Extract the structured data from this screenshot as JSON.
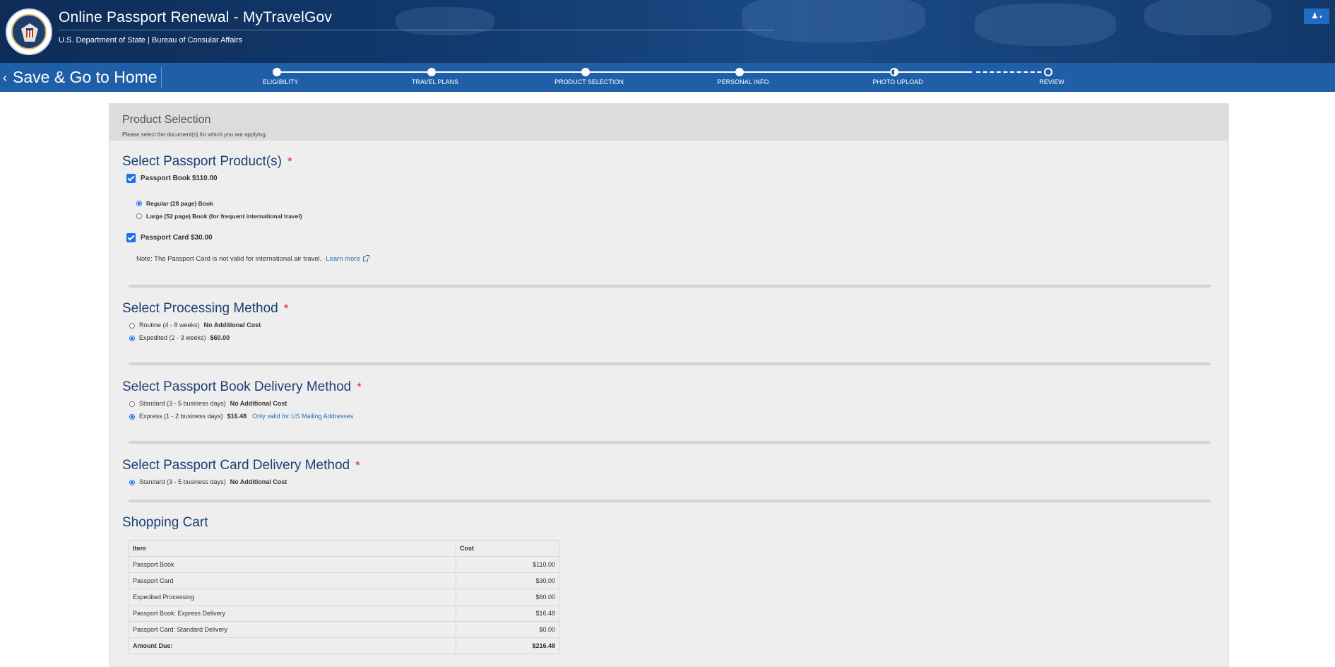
{
  "header": {
    "title": "Online Passport Renewal - MyTravelGov",
    "subtitle": "U.S. Department of State | Bureau of Consular Affairs",
    "seal_icon": "department-of-state-seal",
    "user_menu_icon": "user-icon"
  },
  "nav": {
    "back_label": "Save & Go to Home",
    "steps": [
      {
        "label": "ELIGIBILITY",
        "state": "complete"
      },
      {
        "label": "TRAVEL PLANS",
        "state": "complete"
      },
      {
        "label": "PRODUCT SELECTION",
        "state": "complete"
      },
      {
        "label": "PERSONAL INFO",
        "state": "complete"
      },
      {
        "label": "PHOTO UPLOAD",
        "state": "current"
      },
      {
        "label": "REVIEW",
        "state": "incomplete"
      }
    ]
  },
  "panel": {
    "title": "Product Selection",
    "description": "Please select the document(s) for which you are applying."
  },
  "products": {
    "title": "Select Passport Product(s)",
    "required_mark": "*",
    "book": {
      "label": "Passport Book",
      "price": "$110.00",
      "checked": true
    },
    "book_options": [
      {
        "label": "Regular (28 page) Book",
        "selected": true
      },
      {
        "label": "Large (52 page) Book (for frequent international travel)",
        "selected": false
      }
    ],
    "card": {
      "label": "Passport Card",
      "price": "$30.00",
      "checked": true
    },
    "card_note": "Note: The Passport Card is not valid for international air travel.",
    "learn_more": "Learn more"
  },
  "processing": {
    "title": "Select Processing Method",
    "required_mark": "*",
    "options": [
      {
        "label": "Routine (4 - 8 weeks)",
        "cost": "No Additional Cost",
        "selected": false
      },
      {
        "label": "Expedited (2 - 3 weeks)",
        "cost": "$60.00",
        "selected": true
      }
    ]
  },
  "book_delivery": {
    "title": "Select Passport Book Delivery Method",
    "required_mark": "*",
    "options": [
      {
        "label": "Standard (3 - 5 business days)",
        "cost": "No Additional Cost",
        "note": "",
        "selected": false
      },
      {
        "label": "Express (1 - 2 business days)",
        "cost": "$16.48",
        "note": "Only valid for US Mailing Addresses",
        "selected": true
      }
    ]
  },
  "card_delivery": {
    "title": "Select Passport Card Delivery Method",
    "required_mark": "*",
    "options": [
      {
        "label": "Standard (3 - 5 business days)",
        "cost": "No Additional Cost",
        "selected": true
      }
    ]
  },
  "cart": {
    "title": "Shopping Cart",
    "headers": [
      "Item",
      "Cost"
    ],
    "rows": [
      {
        "item": "Passport Book",
        "cost": "$110.00"
      },
      {
        "item": "Passport Card",
        "cost": "$30.00"
      },
      {
        "item": "Expedited Processing",
        "cost": "$60.00"
      },
      {
        "item": "Passport Book: Express Delivery",
        "cost": "$16.48"
      },
      {
        "item": "Passport Card: Standard Delivery",
        "cost": "$0.00"
      }
    ],
    "total_label": "Amount Due:",
    "total": "$216.48"
  },
  "colors": {
    "header_bg": "#123a6e",
    "nav_bg": "#1f5fa8",
    "heading": "#1c3f73",
    "required": "#d9262e",
    "accent": "#1a73e8",
    "link": "#2b6cb0"
  }
}
